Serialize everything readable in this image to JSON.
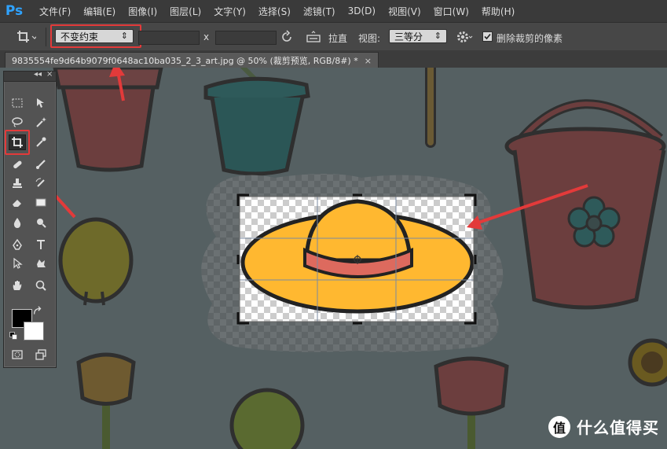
{
  "app": {
    "logo": "Ps"
  },
  "menubar": {
    "items": [
      {
        "label": "文件(F)"
      },
      {
        "label": "编辑(E)"
      },
      {
        "label": "图像(I)"
      },
      {
        "label": "图层(L)"
      },
      {
        "label": "文字(Y)"
      },
      {
        "label": "选择(S)"
      },
      {
        "label": "滤镜(T)"
      },
      {
        "label": "3D(D)"
      },
      {
        "label": "视图(V)"
      },
      {
        "label": "窗口(W)"
      },
      {
        "label": "帮助(H)"
      }
    ]
  },
  "options": {
    "ratio_preset": "不变约束",
    "ratio_width": "",
    "ratio_x": "x",
    "ratio_height": "",
    "straighten_label": "拉直",
    "view_label": "视图:",
    "view_value": "三等分",
    "delete_cropped_label": "删除裁剪的像素",
    "delete_cropped_checked": true
  },
  "document_tab": {
    "title": "9835554fe9d64b9079f0648ac10ba035_2_3_art.jpg @ 50% (裁剪预览, RGB/8#) *",
    "close": "×"
  },
  "toolbox": {
    "collapse": "◂◂",
    "close": "×"
  },
  "watermark": {
    "logo_text": "值",
    "text": "什么值得买"
  },
  "colors": {
    "accent_red": "#e33a3a",
    "hat_yellow": "#ffb830",
    "hat_band": "#dd6a5e",
    "pot_red": "#7a3e3e",
    "pot_teal": "#2e5a5a",
    "canvas_bg": "#556062"
  }
}
